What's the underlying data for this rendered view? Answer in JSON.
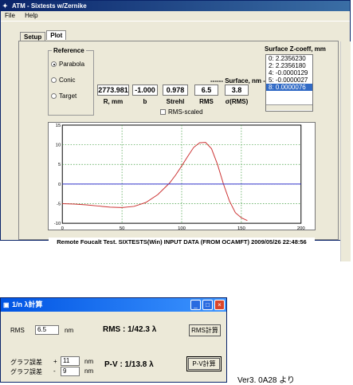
{
  "main_window": {
    "title": "ATM - Sixtests w/Zernike",
    "title_icon": "compass-icon",
    "menu": [
      "File",
      "Help"
    ],
    "tabs": [
      {
        "label": "Setup"
      },
      {
        "label": "Plot"
      }
    ],
    "reference": {
      "legend": "Reference",
      "options": [
        "Parabola",
        "Conic",
        "Target"
      ],
      "selected": "Parabola"
    },
    "surface_header": "------ Surface, nm ------",
    "values": [
      {
        "value": "2773.981",
        "label": "R, mm"
      },
      {
        "value": "-1.000",
        "label": "b"
      },
      {
        "value": "0.978",
        "label": "Strehl"
      },
      {
        "value": "6.5",
        "label": "RMS"
      },
      {
        "value": "3.8",
        "label": "σ(RMS)"
      }
    ],
    "rms_scaled_label": "RMS-scaled",
    "rms_scaled_checked": false,
    "zcoeff": {
      "title": "Surface Z-coeff, mm",
      "items": [
        "0:  2.2356230",
        "2:  2.2356180",
        "4: -0.0000129",
        "5: -0.0000027",
        "8:  0.0000076"
      ],
      "selected_index": 4
    },
    "caption": "Remote Foucalt Test. SIXTESTS(Win) INPUT DATA (FROM OCAMFT) 2009/05/26 22:48:56"
  },
  "chart_data": {
    "type": "line",
    "title": "",
    "xlabel": "",
    "ylabel": "",
    "xlim": [
      0,
      200
    ],
    "ylim": [
      -10,
      15
    ],
    "x_ticks": [
      0,
      50,
      100,
      150,
      200
    ],
    "y_ticks": [
      -10,
      -5,
      0,
      5,
      10,
      15
    ],
    "grid": true,
    "series": [
      {
        "color": "#cc3333",
        "x": [
          0,
          10,
          20,
          30,
          40,
          50,
          60,
          70,
          80,
          90,
          95,
          100,
          105,
          110,
          115,
          120,
          125,
          130,
          135,
          140,
          145,
          150,
          155
        ],
        "y": [
          -5,
          -5.1,
          -5.3,
          -5.6,
          -5.9,
          -6.0,
          -5.7,
          -4.7,
          -2.7,
          0.3,
          2.3,
          4.6,
          7.0,
          9.3,
          10.5,
          10.6,
          9.0,
          5.0,
          0,
          -4.3,
          -7.3,
          -8.6,
          -9.3
        ]
      },
      {
        "color": "#3333cc",
        "x": [
          0,
          200
        ],
        "y": [
          0,
          0
        ]
      }
    ]
  },
  "small_window": {
    "title": "1/n λ計算",
    "title_icon": "app-icon",
    "rms_label": "RMS",
    "rms_value": "6.5",
    "rms_unit": "nm",
    "rms_result": "RMS : 1/42.3 λ",
    "rms_button": "RMS計算",
    "graph_err_label_1": "グラフ誤差",
    "graph_err_label_2": "グラフ誤差",
    "plus_sign": "+",
    "minus_sign": "-",
    "err_plus": "11",
    "err_minus": "9",
    "err_unit_1": "nm",
    "err_unit_2": "nm",
    "pv_result": "P-V : 1/13.8 λ",
    "pv_button": "P-V計算",
    "controls": [
      "minimize-icon",
      "maximize-icon",
      "close-icon"
    ]
  },
  "version_text": "Ver3. 0A28 より"
}
